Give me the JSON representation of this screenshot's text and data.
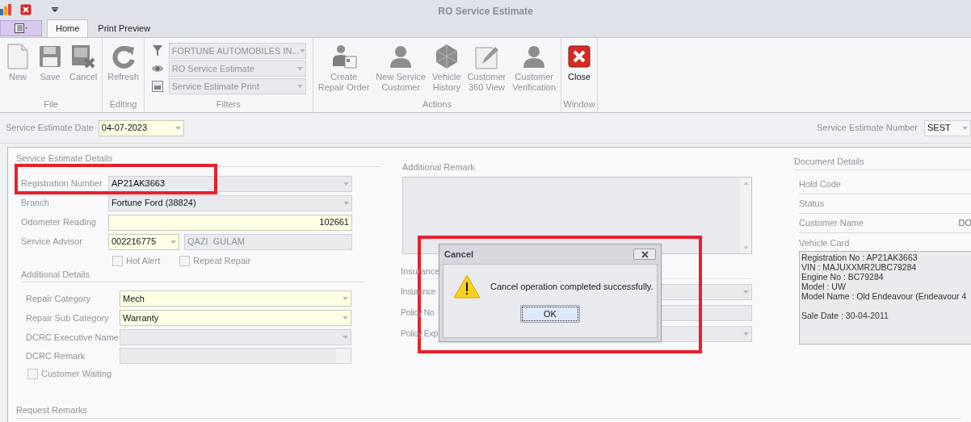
{
  "window": {
    "title": "RO Service Estimate"
  },
  "tabs": [
    {
      "label": "Home",
      "selected": true
    },
    {
      "label": "Print Preview",
      "selected": false
    }
  ],
  "ribbon": {
    "groups": [
      {
        "label": "File",
        "kind": "buttons",
        "buttons": [
          {
            "label": "New",
            "disabled": true
          },
          {
            "label": "Save",
            "disabled": true
          },
          {
            "label": "Cancel",
            "disabled": true
          }
        ]
      },
      {
        "label": "Editing",
        "kind": "buttons",
        "buttons": [
          {
            "label": "Refresh",
            "disabled": true
          }
        ]
      },
      {
        "label": "Filters",
        "kind": "combos",
        "combos": [
          {
            "value": "FORTUNE AUTOMOBILES IN..."
          },
          {
            "value": "RO Service Estimate"
          },
          {
            "value": "Service Estimate Print"
          }
        ]
      },
      {
        "label": "Actions",
        "kind": "buttons",
        "buttons": [
          {
            "label": "Create\nRepair Order",
            "disabled": true
          },
          {
            "label": "New Service\nCustomer",
            "disabled": true
          },
          {
            "label": "Vehicle\nHistory",
            "disabled": true
          },
          {
            "label": "Customer\n360 View",
            "disabled": true
          },
          {
            "label": "Customer\nVerification",
            "disabled": true
          }
        ]
      },
      {
        "label": "Window",
        "kind": "buttons",
        "buttons": [
          {
            "label": "Close",
            "disabled": false
          }
        ]
      }
    ]
  },
  "header": {
    "date": {
      "label": "Service Estimate Date",
      "value": "04-07-2023"
    },
    "number": {
      "label": "Service Estimate Number",
      "value": "SEST"
    }
  },
  "service_estimate_details": {
    "title": "Service Estimate Details",
    "fields": [
      {
        "label": "Registration Number",
        "kind": "combo",
        "value": "AP21AK3663",
        "required": false
      },
      {
        "label": "Branch",
        "kind": "combo",
        "value": "Fortune Ford (38824)",
        "required": false
      },
      {
        "label": "Odometer Reading",
        "kind": "number",
        "value": "102661",
        "required": true
      },
      {
        "label": "Service Advisor",
        "kind": "pair",
        "value": "002216775",
        "second_value": "QAZI  GULAM",
        "required": true
      }
    ],
    "checkboxes": [
      {
        "label": "Hot Alert",
        "checked": false
      },
      {
        "label": "Repeat Repair",
        "checked": false
      }
    ]
  },
  "additional_details": {
    "title": "Additional Details",
    "fields": [
      {
        "label": "Repair Category",
        "kind": "combo",
        "value": "Mech",
        "required": true
      },
      {
        "label": "Repair Sub Category",
        "kind": "combo",
        "value": "Warranty",
        "required": true
      },
      {
        "label": "DCRC Executive Name",
        "kind": "combo",
        "required": false
      },
      {
        "label": "DCRC Remark",
        "kind": "memo",
        "required": false
      }
    ],
    "checkboxes": [
      {
        "label": "Customer Waiting",
        "checked": false
      }
    ]
  },
  "request_remarks": {
    "title": "Request Remarks"
  },
  "additional_remark": {
    "label": "Additional Remark"
  },
  "insurance": {
    "title": "Insurance",
    "fields": [
      {
        "label": "Insurance",
        "kind": "combo"
      },
      {
        "label": "Policy No",
        "kind": "text"
      },
      {
        "label": "Policy Exp",
        "kind": "combo"
      }
    ]
  },
  "document_details": {
    "title": "Document Details",
    "fields": [
      {
        "label": "Hold Code"
      },
      {
        "label": "Status"
      },
      {
        "label": "Customer Name",
        "value": "DO"
      }
    ],
    "vehicle_card": {
      "label": "Vehicle Card",
      "lines": [
        "Registration No : AP21AK3663",
        "VIN : MAJUXXMR2UBC79284",
        "Engine No : BC79284",
        "Model : UW",
        "Model Name : Old Endeavour (Endeavour 4",
        "Sale Date : 30-04-2011"
      ]
    }
  },
  "dialog": {
    "title": "Cancel",
    "message": "Cancel operation completed successfully.",
    "buttons": [
      {
        "label": "OK",
        "focused": true
      }
    ]
  }
}
